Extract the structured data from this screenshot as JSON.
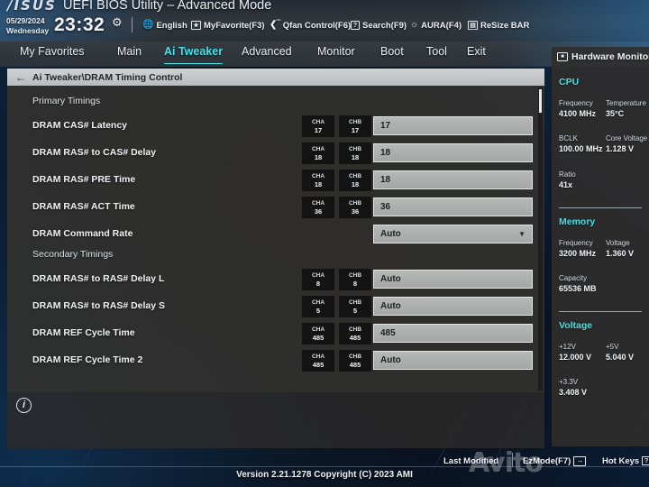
{
  "header": {
    "logo": "/ISUS",
    "title": "UEFI BIOS Utility – Advanced Mode",
    "date": "05/29/2024",
    "weekday": "Wednesday",
    "time": "23:32",
    "gear_icon": "gear-icon",
    "quick_items": [
      {
        "icon": "globe-icon",
        "label": "English"
      },
      {
        "icon": "star-page-icon",
        "label": "MyFavorite(F3)"
      },
      {
        "icon": "fan-icon",
        "label": "Qfan Control(F6)"
      },
      {
        "icon": "question-icon",
        "label": "Search(F9)"
      },
      {
        "icon": "aura-icon",
        "label": "AURA(F4)"
      },
      {
        "icon": "resize-bar-icon",
        "label": "ReSize BAR"
      }
    ]
  },
  "menu": {
    "tabs": [
      {
        "label": "My Favorites",
        "active": false
      },
      {
        "label": "Main",
        "active": false
      },
      {
        "label": "Ai Tweaker",
        "active": true
      },
      {
        "label": "Advanced",
        "active": false
      },
      {
        "label": "Monitor",
        "active": false
      },
      {
        "label": "Boot",
        "active": false
      },
      {
        "label": "Tool",
        "active": false
      },
      {
        "label": "Exit",
        "active": false
      }
    ],
    "active_color": "#3fe3e8"
  },
  "breadcrumb": {
    "back_icon": "arrow-left-icon",
    "path": "Ai Tweaker\\DRAM Timing Control"
  },
  "main": {
    "sections": [
      {
        "title": "Primary Timings"
      },
      {
        "title": "Secondary Timings"
      }
    ],
    "rows": [
      {
        "label": "DRAM CAS# Latency",
        "cha_name": "CHA",
        "cha": "17",
        "chb_name": "CHB",
        "chb": "17",
        "value": "17",
        "type": "input"
      },
      {
        "label": "DRAM RAS# to CAS# Delay",
        "cha_name": "CHA",
        "cha": "18",
        "chb_name": "CHB",
        "chb": "18",
        "value": "18",
        "type": "input"
      },
      {
        "label": "DRAM RAS# PRE Time",
        "cha_name": "CHA",
        "cha": "18",
        "chb_name": "CHB",
        "chb": "18",
        "value": "18",
        "type": "input"
      },
      {
        "label": "DRAM RAS# ACT Time",
        "cha_name": "CHA",
        "cha": "36",
        "chb_name": "CHB",
        "chb": "36",
        "value": "36",
        "type": "input"
      },
      {
        "label": "DRAM Command Rate",
        "cha_name": "",
        "cha": "",
        "chb_name": "",
        "chb": "",
        "value": "Auto",
        "type": "select"
      },
      {
        "label": "DRAM RAS# to RAS# Delay L",
        "cha_name": "CHA",
        "cha": "8",
        "chb_name": "CHB",
        "chb": "8",
        "value": "Auto",
        "type": "input"
      },
      {
        "label": "DRAM RAS# to RAS# Delay S",
        "cha_name": "CHA",
        "cha": "5",
        "chb_name": "CHB",
        "chb": "5",
        "value": "Auto",
        "type": "input"
      },
      {
        "label": "DRAM REF Cycle Time",
        "cha_name": "CHA",
        "cha": "485",
        "chb_name": "CHB",
        "chb": "485",
        "value": "485",
        "type": "input"
      },
      {
        "label": "DRAM REF Cycle Time 2",
        "cha_name": "CHA",
        "cha": "485",
        "chb_name": "CHB",
        "chb": "485",
        "value": "Auto",
        "type": "input"
      }
    ],
    "caret": "▼",
    "info_icon": "info-icon"
  },
  "sidebar": {
    "title": "Hardware Monitor",
    "title_icon": "monitor-icon",
    "groups": [
      {
        "name": "CPU",
        "cells": [
          {
            "key": "Frequency",
            "val": "4100 MHz"
          },
          {
            "key": "Temperature",
            "val": "35°C"
          },
          {
            "key": "BCLK",
            "val": "100.00 MHz"
          },
          {
            "key": "Core Voltage",
            "val": "1.128 V"
          },
          {
            "key": "Ratio",
            "val": "41x"
          }
        ]
      },
      {
        "name": "Memory",
        "cells": [
          {
            "key": "Frequency",
            "val": "3200 MHz"
          },
          {
            "key": "Voltage",
            "val": "1.360 V"
          },
          {
            "key": "Capacity",
            "val": "65536 MB"
          }
        ]
      },
      {
        "name": "Voltage",
        "cells": [
          {
            "key": "+12V",
            "val": "12.000 V"
          },
          {
            "key": "+5V",
            "val": "5.040 V"
          },
          {
            "key": "+3.3V",
            "val": "3.408 V"
          }
        ]
      }
    ],
    "accent_color": "#3fe3e8"
  },
  "footer": {
    "last_modified": "Last Modified",
    "ezmode": "EzMode(F7)",
    "ezmode_icon": "arrow-right-icon",
    "hotkeys": "Hot Keys",
    "hotkeys_icon": "question-icon",
    "version": "Version 2.21.1278 Copyright (C) 2023 AMI"
  },
  "watermark": {
    "text": "Avito"
  }
}
